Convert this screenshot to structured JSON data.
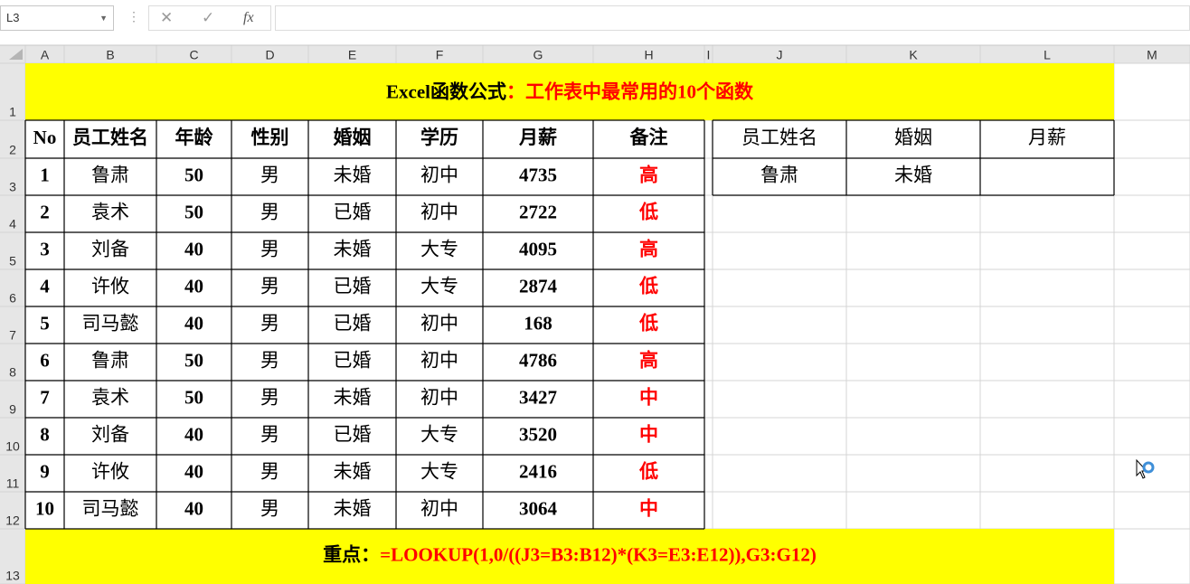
{
  "toolbar": {
    "name_box": "L3",
    "cancel_icon": "✕",
    "enter_icon": "✓",
    "fx_label": "fx",
    "formula": ""
  },
  "columns": [
    "A",
    "B",
    "C",
    "D",
    "E",
    "F",
    "G",
    "H",
    "I",
    "J",
    "K",
    "L",
    "M"
  ],
  "rows": [
    "1",
    "2",
    "3",
    "4",
    "5",
    "6",
    "7",
    "8",
    "9",
    "10",
    "11",
    "12",
    "13"
  ],
  "title": {
    "prefix": "Excel函数公式",
    "colon": "：",
    "text": "工作表中最常用的10个函数"
  },
  "table": {
    "headers": [
      "No",
      "员工姓名",
      "年龄",
      "性别",
      "婚姻",
      "学历",
      "月薪",
      "备注"
    ],
    "rows": [
      [
        "1",
        "鲁肃",
        "50",
        "男",
        "未婚",
        "初中",
        "4735",
        "高"
      ],
      [
        "2",
        "袁术",
        "50",
        "男",
        "已婚",
        "初中",
        "2722",
        "低"
      ],
      [
        "3",
        "刘备",
        "40",
        "男",
        "未婚",
        "大专",
        "4095",
        "高"
      ],
      [
        "4",
        "许攸",
        "40",
        "男",
        "已婚",
        "大专",
        "2874",
        "低"
      ],
      [
        "5",
        "司马懿",
        "40",
        "男",
        "已婚",
        "初中",
        "168",
        "低"
      ],
      [
        "6",
        "鲁肃",
        "50",
        "男",
        "已婚",
        "初中",
        "4786",
        "高"
      ],
      [
        "7",
        "袁术",
        "50",
        "男",
        "未婚",
        "初中",
        "3427",
        "中"
      ],
      [
        "8",
        "刘备",
        "40",
        "男",
        "已婚",
        "大专",
        "3520",
        "中"
      ],
      [
        "9",
        "许攸",
        "40",
        "男",
        "未婚",
        "大专",
        "2416",
        "低"
      ],
      [
        "10",
        "司马懿",
        "40",
        "男",
        "未婚",
        "初中",
        "3064",
        "中"
      ]
    ]
  },
  "lookup": {
    "headers": [
      "员工姓名",
      "婚姻",
      "月薪"
    ],
    "values": [
      "鲁肃",
      "未婚",
      ""
    ]
  },
  "footer": {
    "label": "重点：",
    "formula": "=LOOKUP(1,0/((J3=B3:B12)*(K3=E3:E12)),G3:G12)"
  },
  "colors": {
    "yellow": "#ffff00",
    "red": "#ff0000",
    "header_bg": "#e6e6e6",
    "grid": "#d4d4d4"
  }
}
